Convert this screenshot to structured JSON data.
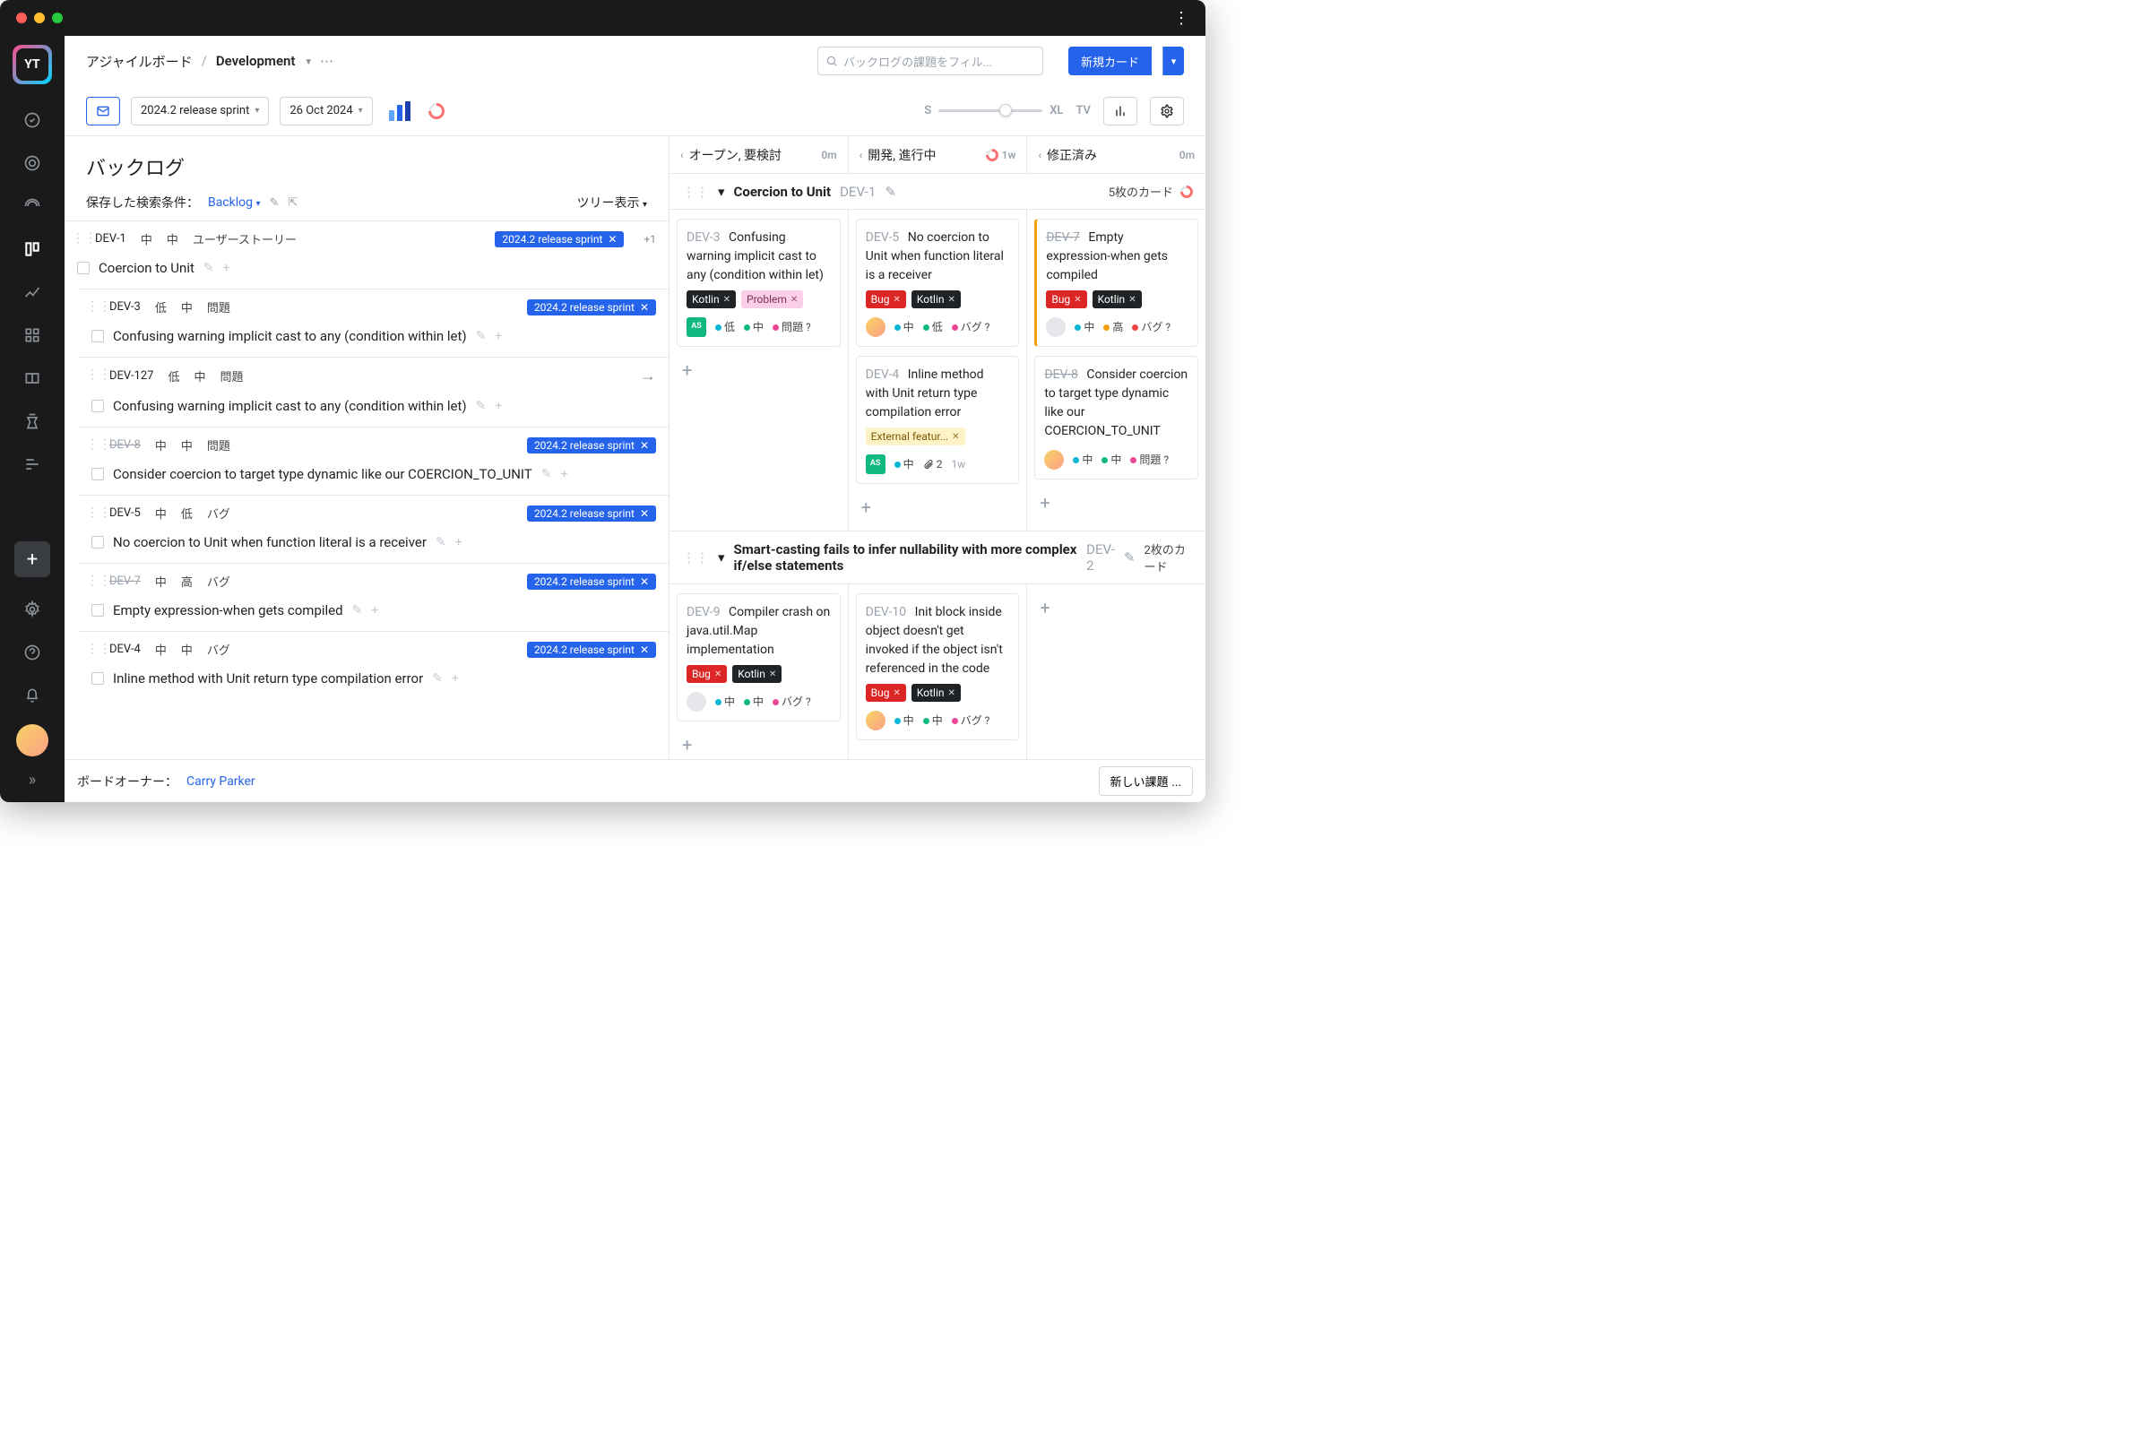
{
  "breadcrumb": {
    "root": "アジャイルボード",
    "project": "Development"
  },
  "search": {
    "placeholder": "バックログの課題をフィル..."
  },
  "buttons": {
    "new_card": "新規カード"
  },
  "toolbar": {
    "sprint": "2024.2 release sprint",
    "date": "26 Oct 2024",
    "zoom_s": "S",
    "zoom_xl": "XL",
    "tv": "TV"
  },
  "backlog": {
    "title": "バックログ",
    "saved_label": "保存した検索条件：",
    "saved_value": "Backlog",
    "view_mode": "ツリー表示",
    "items": [
      {
        "id": "DEV-1",
        "strike": false,
        "p1": "中",
        "p2": "中",
        "type": "ユーザーストーリー",
        "sprint": "2024.2 release sprint",
        "plus1": "+1",
        "title": "Coercion to Unit",
        "child": false
      },
      {
        "id": "DEV-3",
        "strike": false,
        "p1": "低",
        "p2": "中",
        "type": "問題",
        "sprint": "2024.2 release sprint",
        "title": "Confusing warning implicit cast to any (condition within let)",
        "child": true
      },
      {
        "id": "DEV-127",
        "strike": false,
        "p1": "低",
        "p2": "中",
        "type": "問題",
        "arrow": true,
        "title": "Confusing warning implicit cast to any (condition within let)",
        "child": true
      },
      {
        "id": "DEV-8",
        "strike": true,
        "p1": "中",
        "p2": "中",
        "type": "問題",
        "sprint": "2024.2 release sprint",
        "title": "Consider coercion to target type dynamic like our COERCION_TO_UNIT",
        "child": true
      },
      {
        "id": "DEV-5",
        "strike": false,
        "p1": "中",
        "p2": "低",
        "type": "バグ",
        "sprint": "2024.2 release sprint",
        "title": "No coercion to Unit when function literal is a receiver",
        "child": true
      },
      {
        "id": "DEV-7",
        "strike": true,
        "p1": "中",
        "p2": "高",
        "type": "バグ",
        "sprint": "2024.2 release sprint",
        "title": "Empty expression-when gets compiled",
        "child": true
      },
      {
        "id": "DEV-4",
        "strike": false,
        "p1": "中",
        "p2": "中",
        "type": "バグ",
        "sprint": "2024.2 release sprint",
        "title": "Inline method with Unit return type compilation error",
        "child": true
      }
    ]
  },
  "columns": [
    {
      "name": "オープン, 要検討",
      "meta": "0m"
    },
    {
      "name": "開発, 進行中",
      "meta": "1w",
      "pie": true
    },
    {
      "name": "修正済み",
      "meta": "0m"
    }
  ],
  "swimlanes": [
    {
      "name": "Coercion to Unit",
      "id": "DEV-1",
      "count": "5枚のカード",
      "pie": true,
      "cols": [
        [
          {
            "id": "DEV-3",
            "title": "Confusing warning implicit cast to any (condition within let)",
            "tags": [
              [
                "kotlin",
                "Kotlin"
              ],
              [
                "problem",
                "Problem"
              ]
            ],
            "av": "green",
            "f": [
              [
                "teal",
                "低"
              ],
              [
                "green",
                "中"
              ],
              [
                "pink",
                "問題 ?"
              ]
            ]
          }
        ],
        [
          {
            "id": "DEV-5",
            "title": "No coercion to Unit when function literal is a receiver",
            "tags": [
              [
                "bug",
                "Bug"
              ],
              [
                "kotlin",
                "Kotlin"
              ]
            ],
            "av": "photo",
            "f": [
              [
                "teal",
                "中"
              ],
              [
                "green",
                "低"
              ],
              [
                "pink",
                "バグ ?"
              ]
            ]
          },
          {
            "id": "DEV-4",
            "title": "Inline method with Unit return type compilation error",
            "tags": [
              [
                "ext",
                "External featur..."
              ]
            ],
            "av": "green",
            "f": [
              [
                "teal",
                "中"
              ]
            ],
            "attach": "2",
            "time": "1w"
          }
        ],
        [
          {
            "id": "DEV-7",
            "strike": true,
            "bar": true,
            "title": "Empty expression-when gets compiled",
            "tags": [
              [
                "bug",
                "Bug"
              ],
              [
                "kotlin",
                "Kotlin"
              ]
            ],
            "av": "gray",
            "f": [
              [
                "teal",
                "中"
              ],
              [
                "orange",
                "高"
              ],
              [
                "red",
                "バグ ?"
              ]
            ]
          },
          {
            "id": "DEV-8",
            "strike": true,
            "title": "Consider coercion to target type dynamic like our COERCION_TO_UNIT",
            "av": "photo",
            "f": [
              [
                "teal",
                "中"
              ],
              [
                "green",
                "中"
              ],
              [
                "pink",
                "問題 ?"
              ]
            ]
          }
        ]
      ]
    },
    {
      "name": "Smart-casting fails to infer nullability with more complex if/else statements",
      "id": "DEV-2",
      "count": "2枚のカード",
      "cols": [
        [
          {
            "id": "DEV-9",
            "title": "Compiler crash on java.util.Map implementation",
            "tags": [
              [
                "bug",
                "Bug"
              ],
              [
                "kotlin",
                "Kotlin"
              ]
            ],
            "av": "gray",
            "f": [
              [
                "teal",
                "中"
              ],
              [
                "green",
                "中"
              ],
              [
                "pink",
                "バグ ?"
              ]
            ]
          }
        ],
        [
          {
            "id": "DEV-10",
            "title": "Init block inside object doesn't get invoked if the object isn't referenced in the code",
            "tags": [
              [
                "bug",
                "Bug"
              ],
              [
                "kotlin",
                "Kotlin"
              ]
            ],
            "av": "photo",
            "f": [
              [
                "teal",
                "中"
              ],
              [
                "green",
                "中"
              ],
              [
                "pink",
                "バグ ?"
              ]
            ]
          }
        ],
        []
      ]
    }
  ],
  "footer": {
    "owner_label": "ボードオーナー：",
    "owner": "Carry Parker",
    "new_issue": "新しい課題 ..."
  },
  "tag_x": "✕"
}
